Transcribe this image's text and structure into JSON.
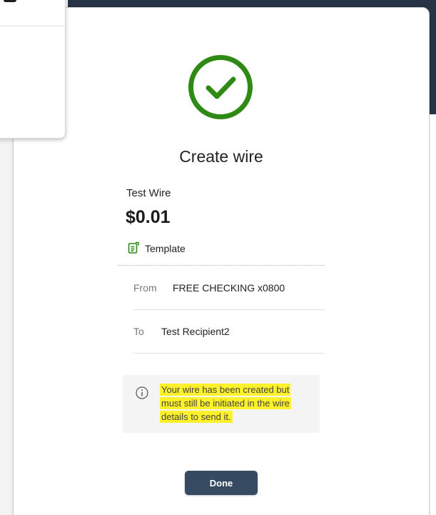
{
  "modal": {
    "title": "Create wire",
    "wire_name": "Test Wire",
    "amount": "$0.01",
    "template_label": "Template",
    "from": {
      "label": "From",
      "value": "FREE CHECKING x0800"
    },
    "to": {
      "label": "To",
      "value": "Test Recipient2"
    },
    "notice_lines": [
      "Your wire has been created but",
      "must still be initiated in the wire",
      "details to send it."
    ],
    "done_label": "Done"
  },
  "icons": {
    "success": "check-circle-icon",
    "template": "template-icon",
    "info": "info-icon"
  },
  "colors": {
    "success_green": "#2e8a14",
    "button_bg": "#364b62",
    "highlight": "#fcf12b",
    "backdrop_dark": "#263446"
  }
}
